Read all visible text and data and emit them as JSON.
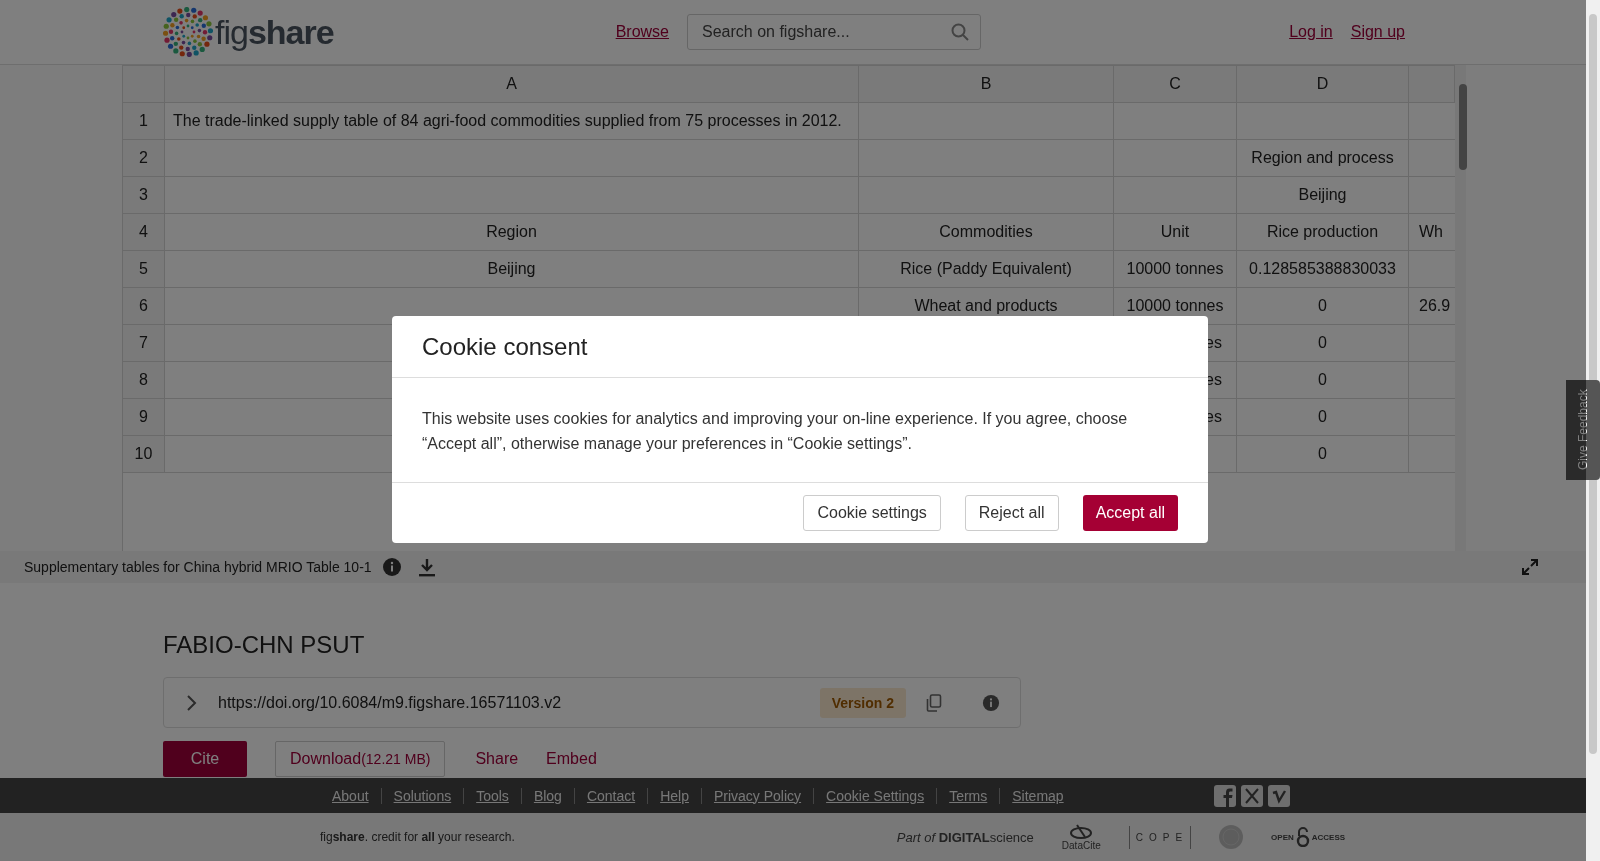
{
  "header": {
    "logo": "fig**share**",
    "nav": [
      "Browse"
    ],
    "search": {
      "placeholder": "Search on figshare..."
    },
    "auth": [
      "Log in",
      "Sign up"
    ]
  },
  "sheet": {
    "columns": [
      "A",
      "B",
      "C",
      "D"
    ],
    "rows": [
      {
        "number": "1",
        "cells": [
          "The trade-linked supply table of 84 agri-food commodities supplied from 75 processes in 2012.",
          null,
          null,
          null,
          null
        ]
      },
      {
        "number": "2",
        "cells": [
          null,
          null,
          null,
          "Region and process",
          null
        ]
      },
      {
        "number": "3",
        "cells": [
          null,
          null,
          null,
          "Beijing",
          null
        ]
      },
      {
        "number": "4",
        "cells": [
          "Region",
          "Commodities",
          "Unit",
          "Rice production",
          "Wh"
        ]
      },
      {
        "number": "5",
        "cells": [
          "Beijing",
          "Rice (Paddy Equivalent)",
          "10000 tonnes",
          "0.128585388830033",
          null
        ]
      },
      {
        "number": "6",
        "cells": [
          null,
          "Wheat and products",
          "10000 tonnes",
          "0",
          "26.9"
        ]
      },
      {
        "number": "7",
        "cells": [
          null,
          null,
          {
            "text": "es",
            "cut": true
          },
          "0",
          null
        ]
      },
      {
        "number": "8",
        "cells": [
          null,
          null,
          {
            "text": "es",
            "cut": true
          },
          "0",
          null
        ]
      },
      {
        "number": "9",
        "cells": [
          null,
          null,
          {
            "text": "es",
            "cut": true
          },
          "0",
          null
        ]
      },
      {
        "number": "10",
        "cells": [
          null,
          null,
          null,
          "0",
          null
        ]
      }
    ]
  },
  "caption": {
    "title": "Supplementary tables for China hybrid MRIO Table 10-1"
  },
  "feedback": "Give Feedback",
  "item": {
    "title": "FABIO-CHN PSUT",
    "doi": "https://doi.org/10.6084/m9.figshare.16571103.v2",
    "version": "Version 2",
    "actions": [
      {
        "kind": "primary",
        "label": "Cite"
      },
      {
        "kind": "outline",
        "label": "Download",
        "size": "(12.21 MB)"
      },
      {
        "kind": "link",
        "label": "Share"
      },
      {
        "kind": "link",
        "label": "Embed"
      }
    ]
  },
  "footer": {
    "links": [
      "About",
      "Solutions",
      "Tools",
      "Blog",
      "Contact",
      "Help",
      "Privacy Policy",
      "Cookie Settings",
      "Terms",
      "Sitemap"
    ],
    "tagline": "fig**share**. credit for **all** your research.",
    "partners": [
      {
        "kind": "digital-science",
        "label": "*Part of* **DIGITAL**science"
      },
      {
        "kind": "datacite",
        "label": "DataCite"
      },
      {
        "kind": "cope",
        "label": "COPE"
      },
      {
        "kind": "seal"
      },
      {
        "kind": "open-access",
        "label": "OPEN",
        "label_2": "ACCESS"
      }
    ]
  },
  "cookie": {
    "title": "Cookie consent",
    "text": "This website uses cookies for analytics and improving your on-line experience. If you agree, choose “Accept all”, otherwise manage your preferences in “Cookie settings”.",
    "buttons": [
      {
        "kind": "outline",
        "label": "Cookie settings"
      },
      {
        "kind": "outline",
        "label": "Reject all"
      },
      {
        "kind": "primary",
        "label": "Accept all"
      }
    ]
  }
}
